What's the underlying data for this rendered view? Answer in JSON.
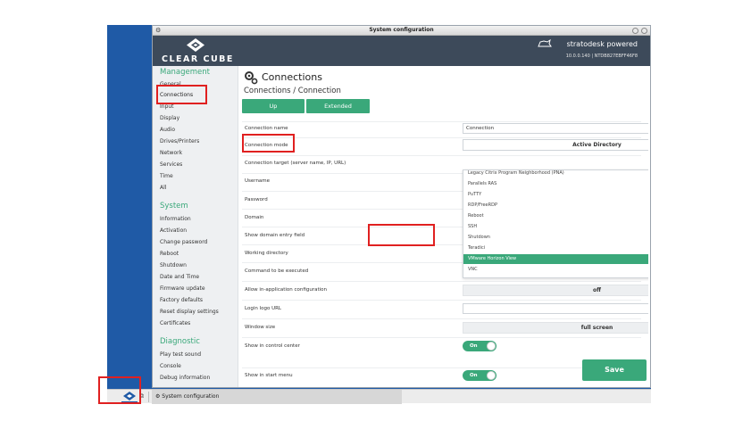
{
  "window": {
    "title": "System configuration"
  },
  "header": {
    "logo_text": "CLEAR CUBE",
    "brand": "stratodesk powered",
    "sub": "10.0.0.140 | NTDB827EBFF46F8"
  },
  "sidebar": {
    "sections": [
      {
        "label": "Management",
        "items": [
          "General",
          "Connections",
          "Input",
          "Display",
          "Audio",
          "Drives/Printers",
          "Network",
          "Services",
          "Time",
          "All"
        ]
      },
      {
        "label": "System",
        "items": [
          "Information",
          "Activation",
          "Change password",
          "Reboot",
          "Shutdown",
          "Date and Time",
          "Firmware update",
          "Factory defaults",
          "Reset display settings",
          "Certificates"
        ]
      },
      {
        "label": "Diagnostic",
        "items": [
          "Play test sound",
          "Console",
          "Debug information"
        ]
      }
    ],
    "active": "Connections"
  },
  "main": {
    "title": "Connections",
    "subtitle": "Connections / Connection",
    "buttons": {
      "up": "Up",
      "extended": "Extended"
    },
    "fields": {
      "connection_name": {
        "label": "Connection name",
        "value": "Connection"
      },
      "connection_mode": {
        "label": "Connection mode",
        "value": "Active Directory"
      },
      "connection_target": {
        "label": "Connection target (server name, IP, URL)"
      },
      "username": {
        "label": "Username"
      },
      "password": {
        "label": "Password"
      },
      "domain": {
        "label": "Domain"
      },
      "show_domain": {
        "label": "Show domain entry field"
      },
      "working_directory": {
        "label": "Working directory"
      },
      "command": {
        "label": "Command to be executed",
        "value": ""
      },
      "allow_inapp": {
        "label": "Allow in-application configuration",
        "value": "off"
      },
      "login_logo": {
        "label": "Login logo URL",
        "value": ""
      },
      "window_size": {
        "label": "Window size",
        "value": "full screen"
      },
      "show_control_center": {
        "label": "Show in control center",
        "value": "On"
      },
      "show_start_menu": {
        "label": "Show in start menu",
        "value": "On"
      }
    },
    "dropdown_options": [
      "Legacy Citrix Program Neighborhood (PNA)",
      "Parallels RAS",
      "PuTTY",
      "RDP/FreeRDP",
      "Reboot",
      "SSH",
      "Shutdown",
      "Teradici",
      "VMware Horizon View",
      "VNC"
    ],
    "dropdown_selected": "VMware Horizon View",
    "save": "Save"
  },
  "taskbar": {
    "task_label": "System configuration"
  },
  "colors": {
    "accent": "#3aa87a",
    "header": "#3d4a5a",
    "desktop": "#1f5aa6",
    "highlight": "#e02020"
  }
}
